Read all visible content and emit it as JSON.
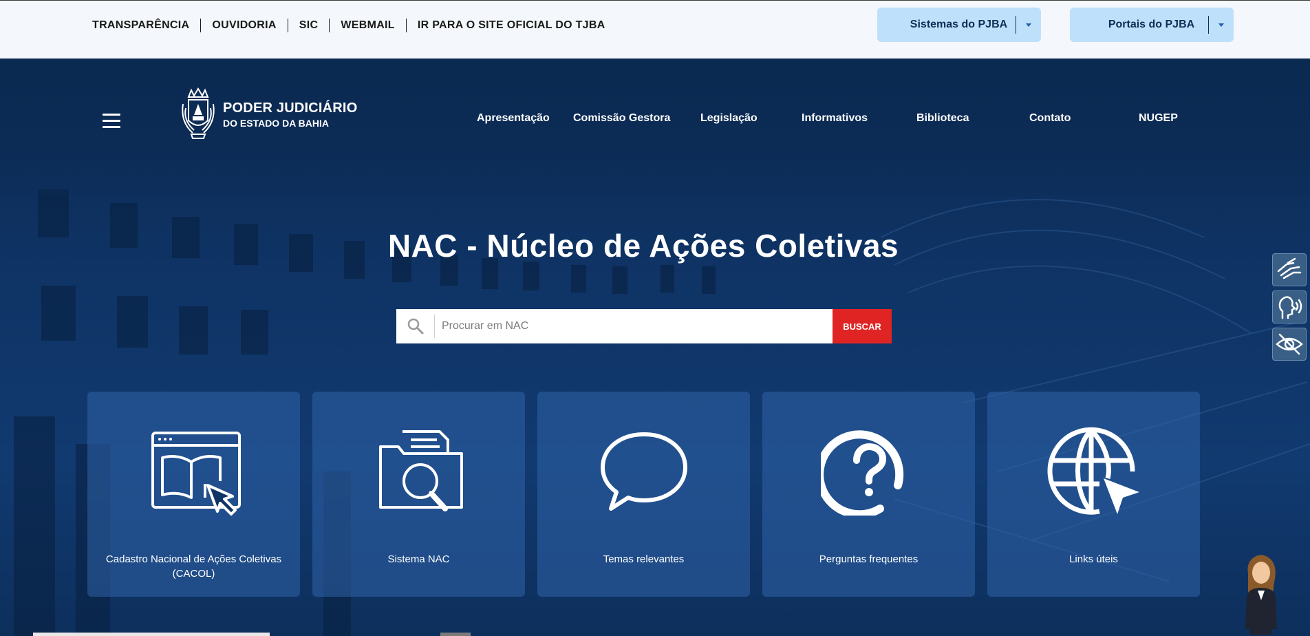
{
  "topbar": {
    "links": [
      "TRANSPARÊNCIA",
      "OUVIDORIA",
      "SIC",
      "WEBMAIL",
      "IR PARA O SITE OFICIAL DO TJBA"
    ],
    "dropdowns": [
      {
        "label": "Sistemas do PJBA"
      },
      {
        "label": "Portais do PJBA"
      }
    ]
  },
  "logo": {
    "line1": "PODER JUDICIÁRIO",
    "line2": "DO ESTADO DA BAHIA",
    "icon": "coat-of-arms-icon"
  },
  "nav": {
    "items": [
      "Apresentação",
      "Comissão Gestora",
      "Legislação",
      "Informativos",
      "Biblioteca",
      "Contato",
      "NUGEP"
    ]
  },
  "hero": {
    "title": "NAC - Núcleo de Ações Coletivas"
  },
  "search": {
    "placeholder": "Procurar em NAC",
    "button_label": "BUSCAR",
    "icon": "search-icon"
  },
  "cards": [
    {
      "label": "Cadastro Nacional de Ações Coletivas (CACOL)",
      "icon": "book-browser-icon"
    },
    {
      "label": "Sistema NAC",
      "icon": "folder-search-icon"
    },
    {
      "label": "Temas relevantes",
      "icon": "speech-bubble-icon"
    },
    {
      "label": "Perguntas frequentes",
      "icon": "question-mark-icon"
    },
    {
      "label": "Links úteis",
      "icon": "globe-pointer-icon"
    }
  ],
  "accessibility": {
    "icons": [
      "sign-language-icon",
      "audio-speech-icon",
      "visibility-icon"
    ]
  },
  "colors": {
    "topbar_bg": "#f4f7fb",
    "dropdown_bg": "#bfe0fa",
    "hero_bg": "#0b2a52",
    "card_bg": "#2f62a8",
    "search_button": "#e02424"
  }
}
